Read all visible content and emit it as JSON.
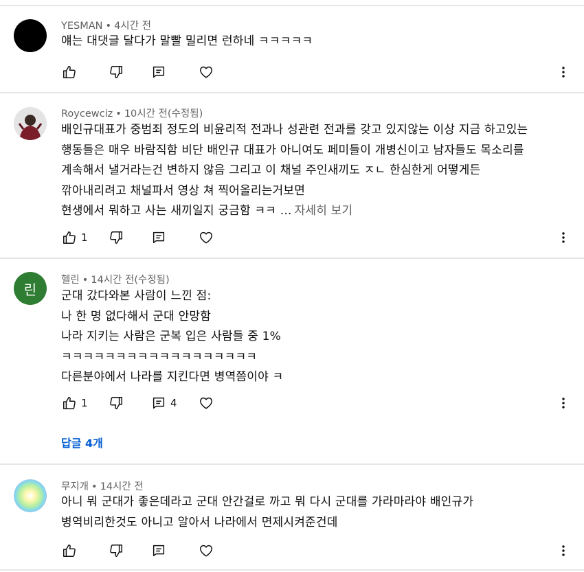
{
  "comments": [
    {
      "author": "YESMAN",
      "time": "4시간 전",
      "edited": "",
      "avatar_color": "#000000",
      "lines": [
        "얘는 대댓글 달다가 말빨 밀리면 런하네 ㅋㅋㅋㅋㅋ"
      ],
      "read_more": "",
      "likes": "",
      "replies_count": ""
    },
    {
      "author": "Roycewciz",
      "time": "10시간 전",
      "edited": "(수정됨)",
      "avatar_color": "#d9d9d9",
      "lines": [
        "배인규대표가 중범죄 정도의  비윤리적 전과나 성관련 전과를 갖고 있지않는 이상  지금 하고있는",
        "행동들은 매우 바람직함 비단 배인규 대표가 아니여도 페미들이 개병신이고 남자들도 목소리를",
        "계속해서 낼거라는건 변하지 않음 그리고 이 채널 주인새끼도 ㅈㄴ 한심한게 어떻게든",
        "깎아내리려고 채널파서 영상 쳐 찍어올리는거보면",
        "현생에서 뭐하고 사는 새끼일지 궁금함 ㅋㅋ ..."
      ],
      "read_more": "자세히 보기",
      "likes": "1",
      "replies_count": ""
    },
    {
      "author": "헬린",
      "time": "14시간 전",
      "edited": "(수정됨)",
      "avatar_letter": "린",
      "avatar_color": "#2e7d32",
      "lines": [
        "군대 갔다와본 사람이 느낀 점:",
        "나 한 명 없다해서 군대 안망함",
        "나라 지키는 사람은 군복 입은 사람들 중 1%",
        "ㅋㅋㅋㅋㅋㅋㅋㅋㅋㅋㅋㅋㅋㅋㅋㅋㅋㅋ",
        "다른분야에서 나라를 지킨다면 병역쯤이야 ㅋ"
      ],
      "read_more": "",
      "likes": "1",
      "replies_count": "4",
      "replies_link": "답글 4개"
    },
    {
      "author": "무지개",
      "time": "14시간 전",
      "edited": "",
      "avatar_color": "#88d8a8",
      "lines": [
        "아니 뭐 군대가 좋은데라고 군대 안간걸로 까고 뭐 다시 군대를 가라마라야 배인규가",
        "병역비리한것도 아니고 알아서 나라에서 면제시켜준건데"
      ],
      "read_more": "",
      "likes": "",
      "replies_count": ""
    }
  ],
  "icons": {
    "like": "thumbs-up-icon",
    "dislike": "thumbs-down-icon",
    "reply": "comment-icon",
    "heart": "heart-icon",
    "more": "more-vert-icon"
  },
  "separator": "•"
}
